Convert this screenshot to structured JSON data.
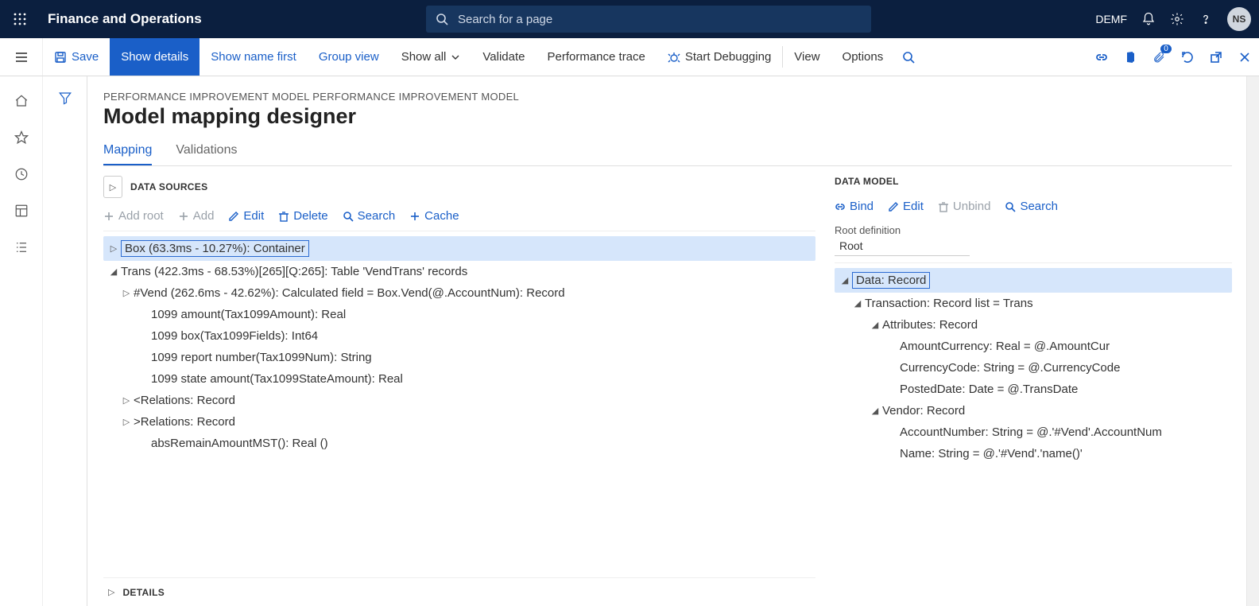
{
  "topbar": {
    "brand": "Finance and Operations",
    "search_placeholder": "Search for a page",
    "company": "DEMF",
    "user_initials": "NS"
  },
  "cmdbar": {
    "save": "Save",
    "show_details": "Show details",
    "show_name_first": "Show name first",
    "group_view": "Group view",
    "show_all": "Show all",
    "validate": "Validate",
    "perf_trace": "Performance trace",
    "start_debugging": "Start Debugging",
    "view": "View",
    "options": "Options",
    "badge": "0"
  },
  "page": {
    "breadcrumb": "PERFORMANCE IMPROVEMENT MODEL PERFORMANCE IMPROVEMENT MODEL",
    "title": "Model mapping designer",
    "tab_mapping": "Mapping",
    "tab_validations": "Validations",
    "details": "DETAILS"
  },
  "ds": {
    "header": "DATA SOURCES",
    "add_root": "Add root",
    "add": "Add",
    "edit": "Edit",
    "delete": "Delete",
    "search": "Search",
    "cache": "Cache",
    "tree": {
      "n0": "Box (63.3ms - 10.27%): Container",
      "n1": "Trans (422.3ms - 68.53%)[265][Q:265]: Table 'VendTrans' records",
      "n2": "#Vend (262.6ms - 42.62%): Calculated field = Box.Vend(@.AccountNum): Record",
      "n3": "1099 amount(Tax1099Amount): Real",
      "n4": "1099 box(Tax1099Fields): Int64",
      "n5": "1099 report number(Tax1099Num): String",
      "n6": "1099 state amount(Tax1099StateAmount): Real",
      "n7": "<Relations: Record",
      "n8": ">Relations: Record",
      "n9": "absRemainAmountMST(): Real ()"
    }
  },
  "dm": {
    "header": "DATA MODEL",
    "bind": "Bind",
    "edit": "Edit",
    "unbind": "Unbind",
    "search": "Search",
    "root_def_label": "Root definition",
    "root_def_value": "Root",
    "tree": {
      "n0": "Data: Record",
      "n1": "Transaction: Record list = Trans",
      "n2": "Attributes: Record",
      "n3": "AmountCurrency: Real = @.AmountCur",
      "n4": "CurrencyCode: String = @.CurrencyCode",
      "n5": "PostedDate: Date = @.TransDate",
      "n6": "Vendor: Record",
      "n7": "AccountNumber: String = @.'#Vend'.AccountNum",
      "n8": "Name: String = @.'#Vend'.'name()'"
    }
  }
}
